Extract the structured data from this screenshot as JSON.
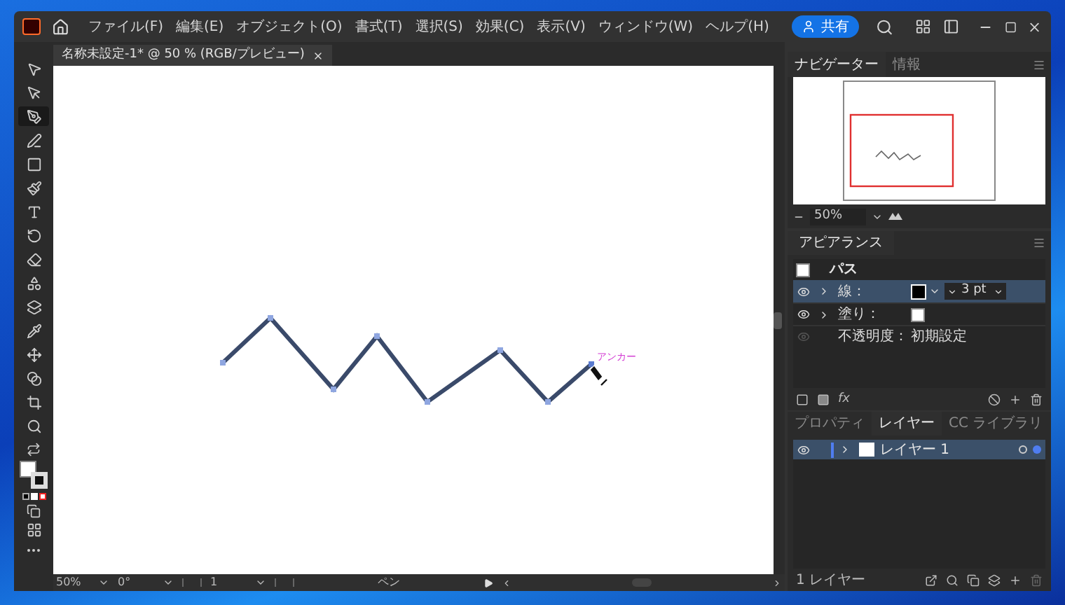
{
  "menu_bar": {
    "items": [
      "ファイル(F)",
      "編集(E)",
      "オブジェクト(O)",
      "書式(T)",
      "選択(S)",
      "効果(C)",
      "表示(V)",
      "ウィンドウ(W)",
      "ヘルプ(H)"
    ],
    "share_button": "共有"
  },
  "document_tab": {
    "title": "名称未設定-1* @ 50 % (RGB/プレビュー)"
  },
  "tools": [
    {
      "kind": "select",
      "selected": false
    },
    {
      "kind": "direct-select",
      "selected": false
    },
    {
      "kind": "pen",
      "selected": true
    },
    {
      "kind": "curvature",
      "selected": false
    },
    {
      "kind": "rectangle",
      "selected": false
    },
    {
      "kind": "brush",
      "selected": false
    },
    {
      "kind": "type",
      "selected": false
    },
    {
      "kind": "rotate",
      "selected": false
    },
    {
      "kind": "eraser",
      "selected": false
    },
    {
      "kind": "shape-builder",
      "selected": false
    },
    {
      "kind": "gradient",
      "selected": false
    },
    {
      "kind": "eyedropper",
      "selected": false
    },
    {
      "kind": "puppet",
      "selected": false
    },
    {
      "kind": "blend",
      "selected": false
    },
    {
      "kind": "artboard",
      "selected": false
    },
    {
      "kind": "zoom",
      "selected": false
    }
  ],
  "canvas": {
    "anchor_label": "アンカー"
  },
  "status_bar": {
    "zoom": "50%",
    "rotation": "0°",
    "artboard": "1",
    "tool": "ペン"
  },
  "navigator": {
    "tabs": [
      {
        "label": "ナビゲーター",
        "selected": true
      },
      {
        "label": "情報",
        "selected": false
      }
    ],
    "zoom": "50%"
  },
  "appearance": {
    "title": "アピアランス",
    "object": "パス",
    "fx_button": "fx",
    "rows": [
      {
        "kind": "stroke",
        "label": "線：",
        "value": "3 pt",
        "visible": true,
        "selected": true
      },
      {
        "kind": "fill",
        "label": "塗り：",
        "visible": true,
        "selected": false
      },
      {
        "kind": "opacity",
        "label": "不透明度：",
        "value": "初期設定",
        "visible": false,
        "selected": false
      }
    ]
  },
  "layers": {
    "tabs": [
      {
        "label": "プロパティ",
        "selected": false
      },
      {
        "label": "レイヤー",
        "selected": true
      },
      {
        "label": "CC ライブラリ",
        "selected": false
      }
    ],
    "items": [
      {
        "name": "レイヤー 1",
        "visible": true,
        "selected": true
      }
    ],
    "footer": "1 レイヤー"
  }
}
